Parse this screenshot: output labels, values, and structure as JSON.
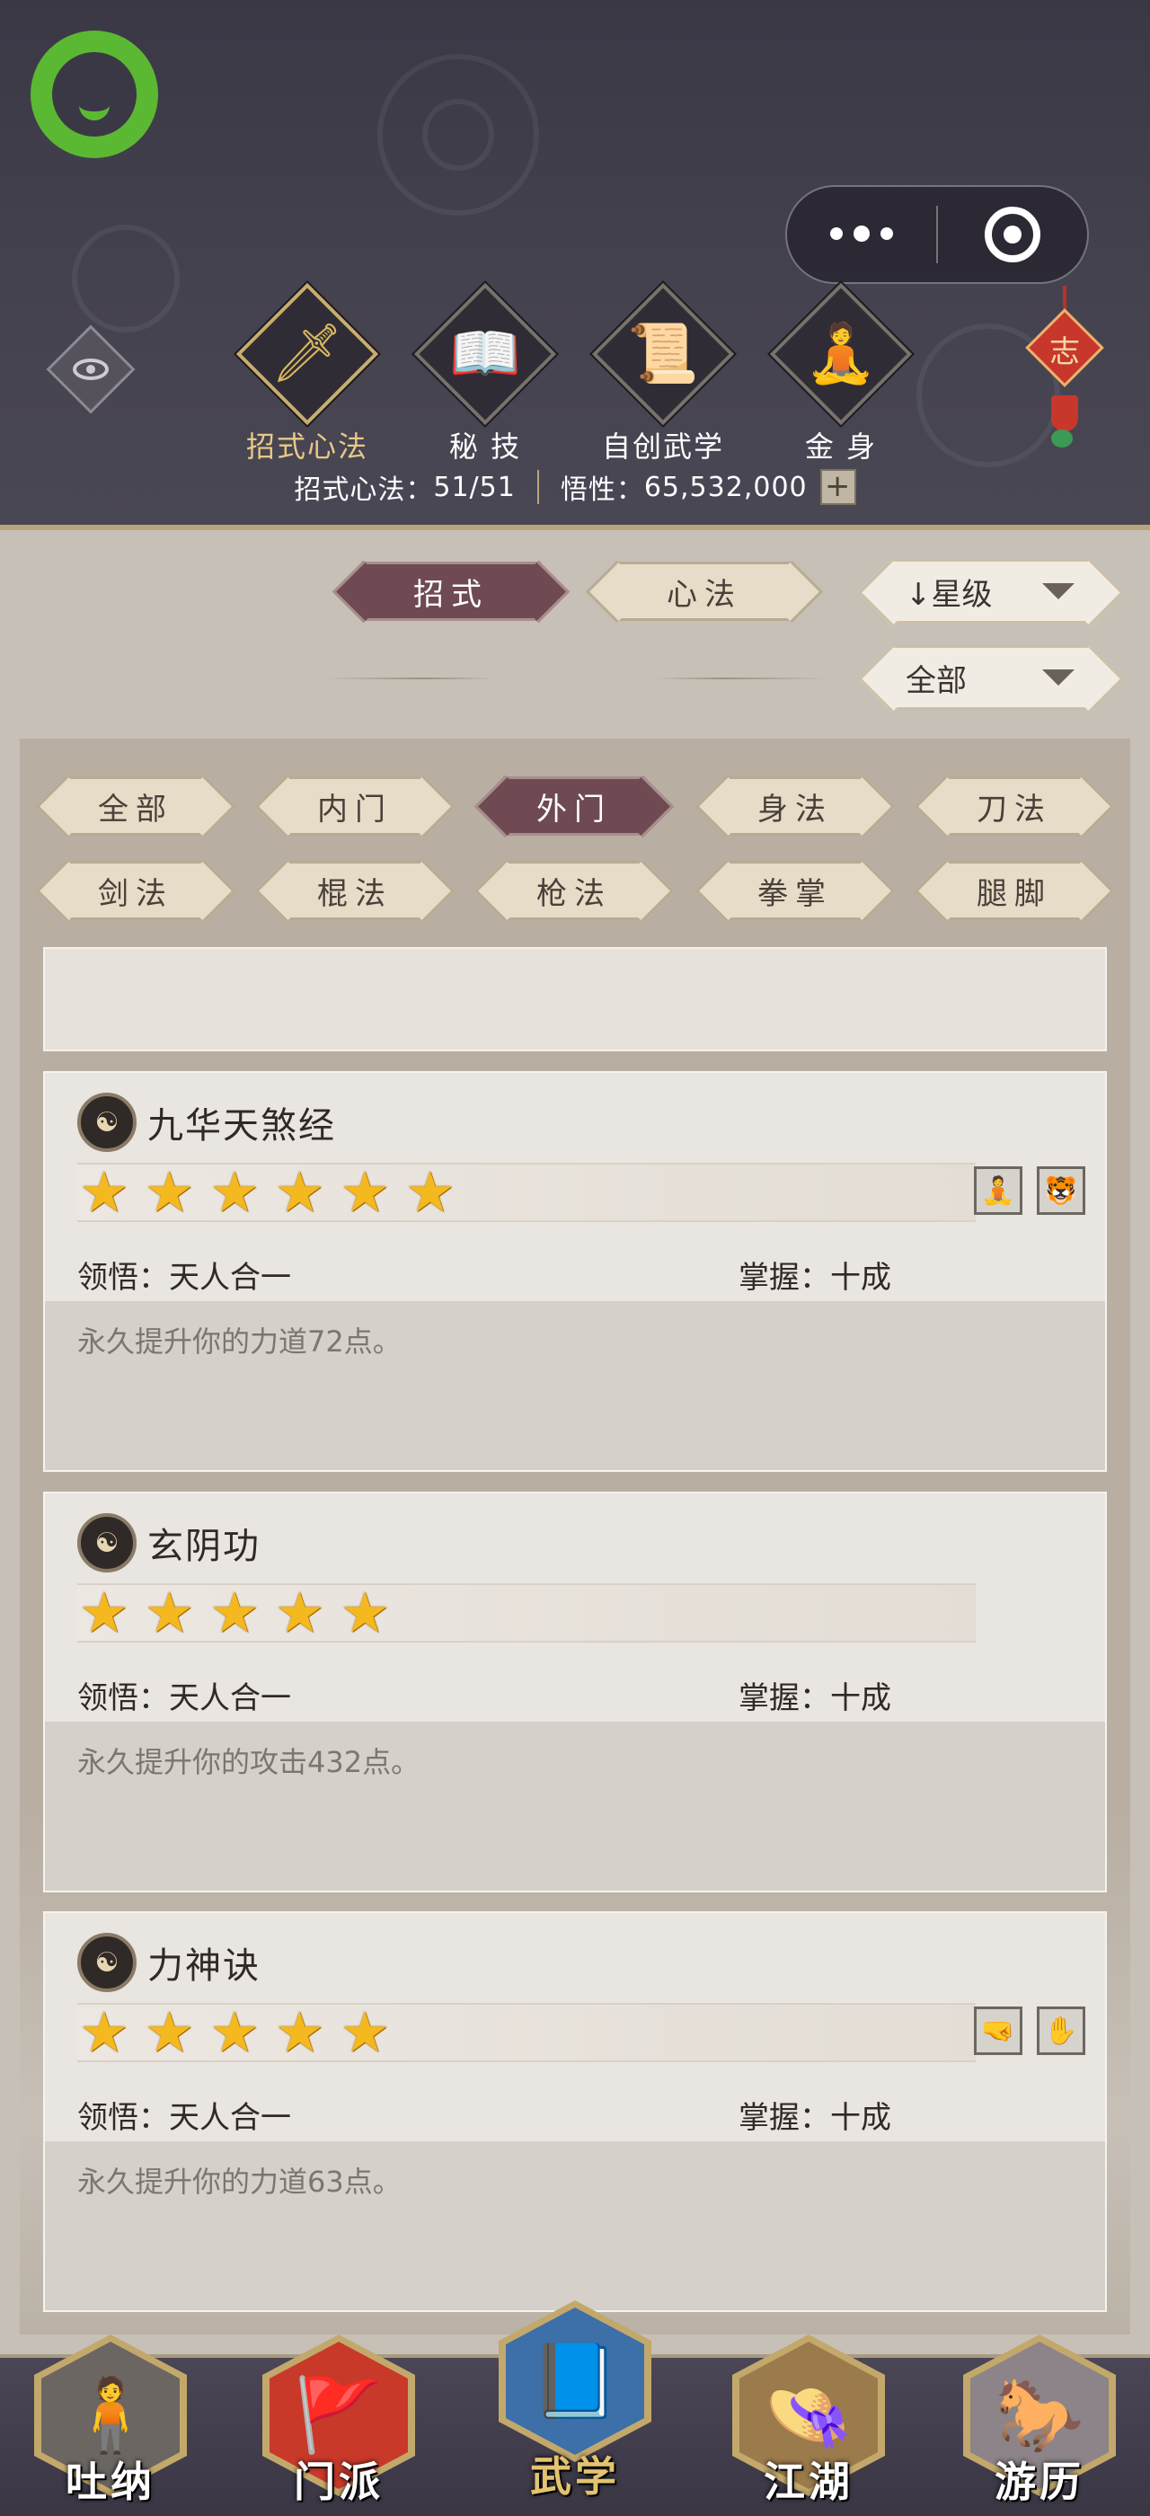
{
  "header": {
    "top_tabs": [
      {
        "label": "招式心法",
        "icon": "sword-icon",
        "glyph": "🗡",
        "active": true
      },
      {
        "label": "秘 技",
        "icon": "book-icon",
        "glyph": "📖",
        "active": false
      },
      {
        "label": "自创武学",
        "icon": "scroll-icon",
        "glyph": "📜",
        "active": false
      },
      {
        "label": "金 身",
        "icon": "meditation-icon",
        "glyph": "🧘",
        "active": false
      }
    ],
    "knot_char": "志",
    "stats": {
      "moves_label": "招式心法：",
      "moves_value": "51/51",
      "insight_label": "悟性：",
      "insight_value": "65,532,000",
      "plus": "+"
    }
  },
  "filters": {
    "type_tabs": [
      {
        "label": "招式",
        "active": true
      },
      {
        "label": "心法",
        "active": false
      }
    ],
    "sort_select": "↓星级",
    "scope_select": "全部",
    "categories": [
      {
        "label": "全部",
        "active": false
      },
      {
        "label": "内门",
        "active": false
      },
      {
        "label": "外门",
        "active": true
      },
      {
        "label": "身法",
        "active": false
      },
      {
        "label": "刀法",
        "active": false
      },
      {
        "label": "剑法",
        "active": false
      },
      {
        "label": "棍法",
        "active": false
      },
      {
        "label": "枪法",
        "active": false
      },
      {
        "label": "拳掌",
        "active": false
      },
      {
        "label": "腿脚",
        "active": false
      }
    ]
  },
  "skills": [
    {
      "name": "九华天煞经",
      "stars": 6,
      "badges": [
        "meditation-badge-icon",
        "tiger-badge-icon"
      ],
      "comprehension_label": "领悟：",
      "comprehension": "天人合一",
      "mastery_label": "掌握：",
      "mastery": "十成",
      "description": "永久提升你的力道72点。"
    },
    {
      "name": "玄阴功",
      "stars": 5,
      "badges": [],
      "comprehension_label": "领悟：",
      "comprehension": "天人合一",
      "mastery_label": "掌握：",
      "mastery": "十成",
      "description": "永久提升你的攻击432点。"
    },
    {
      "name": "力神诀",
      "stars": 5,
      "badges": [
        "fist-badge-icon",
        "palm-badge-icon"
      ],
      "comprehension_label": "领悟：",
      "comprehension": "天人合一",
      "mastery_label": "掌握：",
      "mastery": "十成",
      "description": "永久提升你的力道63点。"
    }
  ],
  "bottom_nav": [
    {
      "label": "吐纳",
      "icon": "breathing-monk-icon",
      "glyph": "🧍",
      "active": false
    },
    {
      "label": "门派",
      "icon": "sect-flag-icon",
      "glyph": "🚩",
      "active": false
    },
    {
      "label": "武学",
      "icon": "martial-book-icon",
      "glyph": "📘",
      "active": true
    },
    {
      "label": "江湖",
      "icon": "bamboo-hat-icon",
      "glyph": "👒",
      "active": false
    },
    {
      "label": "游历",
      "icon": "horse-icon",
      "glyph": "🐎",
      "active": false
    }
  ],
  "colors": {
    "header_bg": "#3f3c4a",
    "active_pill": "#6f4a52",
    "inactive_pill": "#e6dcc7",
    "star_gold": "#f3b91f",
    "miniapp_green": "#5bb833"
  }
}
